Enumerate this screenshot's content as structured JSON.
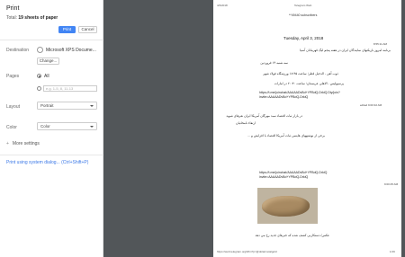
{
  "header": {
    "title": "Print",
    "total_prefix": "Total: ",
    "total_value": "19 sheets of paper"
  },
  "buttons": {
    "print": "Print",
    "cancel": "Cancel"
  },
  "destination": {
    "label": "Destination",
    "printer": "Microsoft XPS Docume...",
    "change": "Change..."
  },
  "pages": {
    "label": "Pages",
    "all": "All",
    "custom_placeholder": "e.g. 1-5, 8, 11-13"
  },
  "layout": {
    "label": "Layout",
    "value": "Portrait"
  },
  "color": {
    "label": "Color",
    "value": "Color"
  },
  "more_settings": {
    "icon": "+",
    "label": "More settings"
  },
  "system_dialog": "Print using system dialog... (Ctrl+Shift+P)",
  "preview": {
    "header_date": "4/3/2018",
    "header_title": "Telegram Web",
    "subscribers": "**49440 subscribers",
    "day": "Tuesday, April 3, 2018",
    "messages": [
      {
        "time": "8:55:11 AM",
        "text_lines": [
          "برنامه امروز بازیکنهای نمایندگان ایران در هفته پنجم لیگ قهرمانان آسیا",
          "سه شنبه ١۴ فروردین",
          "ذوب آهن - الدحیل قطر؛ ساعت ١٨:۴۵ ورزشگاه فولاد شهر",
          "پرسپولیس - الاهلی عربستان؛ ساعت ٢٠:٣٠ در امارات"
        ],
        "link_lines": [
          "https://t.me/joinchat/AAAAADvBd+YPBdQ-DrkiQ.Diy/join?",
          "invite=AAAAADvBd+YPBdQ-DrkiQ"
        ]
      },
      {
        "time": "edited 9:00:32 AM",
        "text_lines": [
          "در بازار ثبات اقتصاد سبد مهرگان آمریکا ایران نقرهای شوید",
          "ارتقاء نامخانیان",
          "برخی از نوشتههای هاینس ثبات آمریکا اقتصاد با افزایش و ..."
        ],
        "link_lines": [
          "https://t.me/joinchat/AAAAADvBd+YPBdQ-DrkiQ",
          "invite=AAAAADvBd+YPBdQ-DrkiQ"
        ]
      },
      {
        "time": "9:00:45 AM",
        "text_lines": [
          "عکس/ دستکارنی کشف شده که خبرهای جدید رخ می دهد"
        ]
      }
    ],
    "footer_url": "https://web.telegram.org/#/im?p=@dolarmetalgold",
    "footer_page": "1/19"
  },
  "colors": {
    "accent": "#4285f4",
    "link": "#3b78e7",
    "preview_bg": "#525659"
  }
}
